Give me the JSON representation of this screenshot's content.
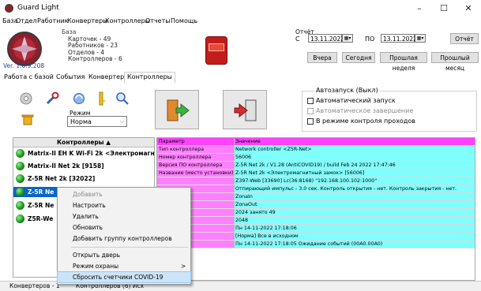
{
  "window": {
    "title": "Guard Light",
    "minimize": "–",
    "maximize": "☐",
    "close": "✕"
  },
  "menu": [
    "База",
    "Отдел",
    "Работник",
    "Конвертеры",
    "Контроллеры",
    "Отчеты",
    "Помощь"
  ],
  "header": {
    "version": "Ver. 1.0.9.208",
    "stats_title": "База",
    "stats": [
      "Карточек - 49",
      "Работников - 23",
      "Отделов - 4",
      "Контроллеров - 6"
    ],
    "alarm_icon": "alarm-button-icon"
  },
  "report": {
    "label": "Отчёт",
    "from_label": "С",
    "from_date": "13.11.2022",
    "to_label": "ПО",
    "to_date": "13.11.2022",
    "report_button": "Отчёт",
    "yesterday": "Вчера",
    "today": "Сегодня",
    "last_week": "Прошлая неделя",
    "last_month": "Прошлый месяц"
  },
  "tabs": [
    "Работа с базой",
    "События",
    "Конвертеры",
    "Контроллеры"
  ],
  "active_tab": "Контроллеры",
  "toolbar": {
    "mode_label": "Режим",
    "mode_value": "Норма"
  },
  "autostart": {
    "title": "Автозапуск (Выкл)",
    "auto_start": "Автоматический запуск",
    "auto_finish": "Автоматическое завершение",
    "pass_control": "В режиме контроля проходов"
  },
  "controllers": {
    "header": "Контроллеры ▲",
    "rows": [
      "Matrix-II EH K Wi-Fi 2k <Электромагн...",
      "Matrix-II Net 2k [9158]",
      "Z-5R Net 2k [32022]",
      "Z-5R Ne",
      "Z-5R Ne",
      "Z5R-We"
    ],
    "selected_index": 3
  },
  "params": {
    "header_param": "Параметр",
    "header_value": "Значение",
    "rows": [
      {
        "name": "Тип контроллера",
        "value": "Network controller <Z5R-Net>"
      },
      {
        "name": "Номер контроллера",
        "value": "56006"
      },
      {
        "name": "Версия ПО контроллера",
        "value": "Z-5R Net 2k / V1.28 (AntiCOVID19) / build Feb 24 2022  17:47:46"
      },
      {
        "name": "Название (место установки)",
        "value": "Z-5R Net 2k <Электромагнитный замок> [56006]"
      },
      {
        "name": "",
        "value": "Z397-Web [33690] Lc(36:8168) \"192.168.100.102:1000\""
      },
      {
        "name": "",
        "value": "Отпирающий импульс - 3.0 сек. Контроль открытия - нет. Контроль закрытия - нет."
      },
      {
        "name": "зона",
        "value": "ZonaIn"
      },
      {
        "name": "а",
        "value": "ZonaOut"
      },
      {
        "name": "",
        "value": "2024 занято 49"
      },
      {
        "name": "ытий",
        "value": "2048"
      },
      {
        "name": "",
        "value": "Пн 14-11-2022 17:18:06"
      },
      {
        "name": "к/дверь",
        "value": "[Норма] Все в исходном"
      },
      {
        "name": "",
        "value": "Пн 14-11-2022 17:18:05 Ожидание событий (00А0.00А0)"
      }
    ]
  },
  "context_menu": {
    "items": [
      "Добавить",
      "Настроить",
      "Удалить",
      "Обновить",
      "Добавить группу контроллеров",
      "Открыть дверь",
      "Режим охраны",
      "Сбросить счетчики COVID-19"
    ],
    "submenu_arrow": ">"
  },
  "statusbar": {
    "left": "Конвертеров - 1",
    "middle": "Контроллеров (6) Исх"
  },
  "colors": {
    "param_header_bg": "#ff40ff",
    "param_name_bg": "#ff80ff",
    "param_value_bg": "#80ffff",
    "selection": "#0a64c8",
    "context_highlight": "#cce4f7"
  }
}
